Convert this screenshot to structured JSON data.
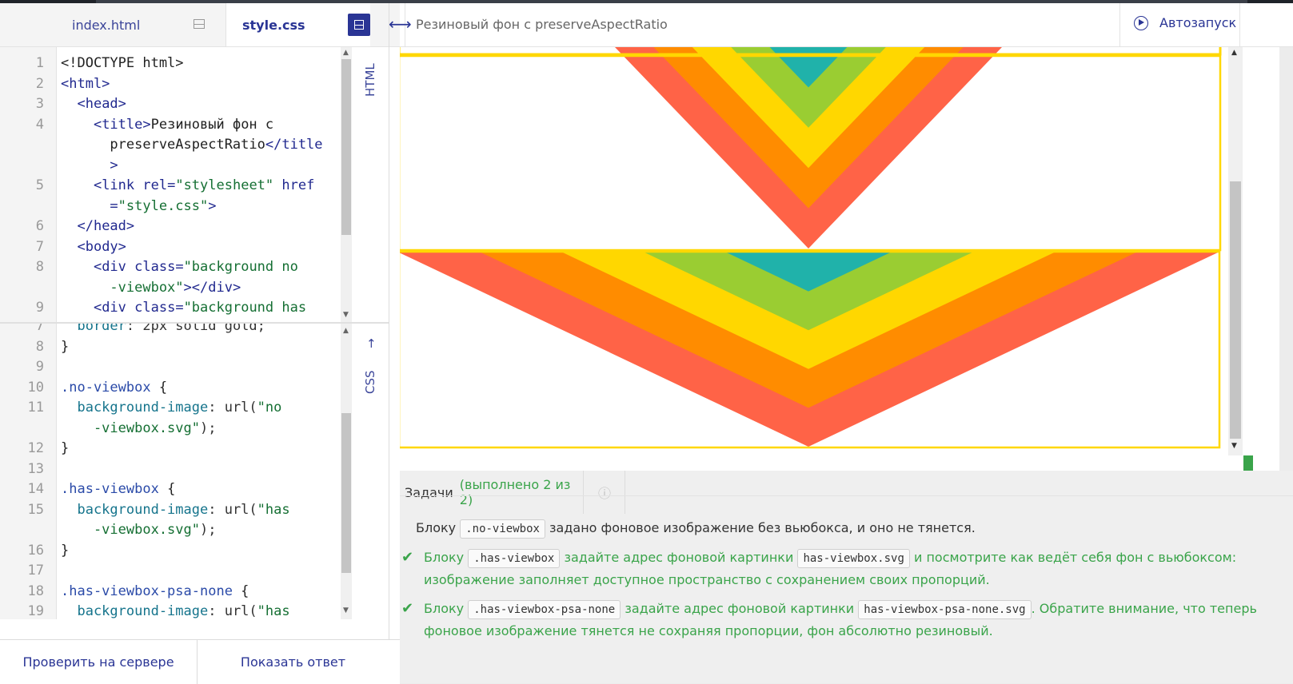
{
  "tabs": {
    "index": "index.html",
    "style": "style.css"
  },
  "side_labels": {
    "html": "HTML",
    "css": "CSS"
  },
  "html_code": {
    "lines": [
      {
        "n": "1",
        "parts": [
          [
            "t-txt",
            "<!DOCTYPE html>"
          ]
        ]
      },
      {
        "n": "2",
        "parts": [
          [
            "t-tag",
            "<html>"
          ]
        ]
      },
      {
        "n": "3",
        "parts": [
          [
            "t-txt",
            "  "
          ],
          [
            "t-tag",
            "<head>"
          ]
        ]
      },
      {
        "n": "4",
        "parts": [
          [
            "t-txt",
            "    "
          ],
          [
            "t-tag",
            "<title>"
          ],
          [
            "t-txt",
            "Резиновый фон с"
          ]
        ]
      },
      {
        "n": "",
        "parts": [
          [
            "t-txt",
            "      preserveAspectRatio"
          ],
          [
            "t-tag",
            "</title"
          ]
        ]
      },
      {
        "n": "",
        "parts": [
          [
            "t-tag",
            "      >"
          ]
        ]
      },
      {
        "n": "5",
        "parts": [
          [
            "t-txt",
            "    "
          ],
          [
            "t-tag",
            "<link "
          ],
          [
            "t-attr",
            "rel="
          ],
          [
            "t-str",
            "\"stylesheet\""
          ],
          [
            "t-attr",
            " href"
          ]
        ]
      },
      {
        "n": "",
        "parts": [
          [
            "t-attr",
            "      ="
          ],
          [
            "t-str",
            "\"style.css\""
          ],
          [
            "t-tag",
            ">"
          ]
        ]
      },
      {
        "n": "6",
        "parts": [
          [
            "t-txt",
            "  "
          ],
          [
            "t-tag",
            "</head>"
          ]
        ]
      },
      {
        "n": "7",
        "parts": [
          [
            "t-txt",
            "  "
          ],
          [
            "t-tag",
            "<body>"
          ]
        ]
      },
      {
        "n": "8",
        "parts": [
          [
            "t-txt",
            "    "
          ],
          [
            "t-tag",
            "<div "
          ],
          [
            "t-attr",
            "class="
          ],
          [
            "t-str",
            "\"background no"
          ]
        ]
      },
      {
        "n": "",
        "parts": [
          [
            "t-str",
            "      -viewbox\""
          ],
          [
            "t-tag",
            "></div>"
          ]
        ]
      },
      {
        "n": "9",
        "parts": [
          [
            "t-txt",
            "    "
          ],
          [
            "t-tag",
            "<div "
          ],
          [
            "t-attr",
            "class="
          ],
          [
            "t-str",
            "\"background has"
          ]
        ]
      }
    ]
  },
  "css_code": {
    "lines": [
      {
        "n": "7",
        "parts": [
          [
            "t-prop",
            "  border"
          ],
          [
            "t-val",
            ": 2px solid gold;"
          ]
        ]
      },
      {
        "n": "8",
        "parts": [
          [
            "t-brace",
            "}"
          ]
        ]
      },
      {
        "n": "9",
        "parts": [
          [
            "t-txt",
            ""
          ]
        ]
      },
      {
        "n": "10",
        "parts": [
          [
            "t-sel",
            ".no-viewbox"
          ],
          [
            "t-brace",
            " {"
          ]
        ]
      },
      {
        "n": "11",
        "parts": [
          [
            "t-prop",
            "  background-image"
          ],
          [
            "t-val",
            ": url("
          ],
          [
            "t-str",
            "\"no"
          ]
        ]
      },
      {
        "n": "",
        "parts": [
          [
            "t-str",
            "    -viewbox.svg\""
          ],
          [
            "t-val",
            ");"
          ]
        ]
      },
      {
        "n": "12",
        "parts": [
          [
            "t-brace",
            "}"
          ]
        ]
      },
      {
        "n": "13",
        "parts": [
          [
            "t-txt",
            ""
          ]
        ]
      },
      {
        "n": "14",
        "parts": [
          [
            "t-sel",
            ".has-viewbox"
          ],
          [
            "t-brace",
            " {"
          ]
        ]
      },
      {
        "n": "15",
        "parts": [
          [
            "t-prop",
            "  background-image"
          ],
          [
            "t-val",
            ": url("
          ],
          [
            "t-str",
            "\"has"
          ]
        ]
      },
      {
        "n": "",
        "parts": [
          [
            "t-str",
            "    -viewbox.svg\""
          ],
          [
            "t-val",
            ");"
          ]
        ]
      },
      {
        "n": "16",
        "parts": [
          [
            "t-brace",
            "}"
          ]
        ]
      },
      {
        "n": "17",
        "parts": [
          [
            "t-txt",
            ""
          ]
        ]
      },
      {
        "n": "18",
        "parts": [
          [
            "t-sel",
            ".has-viewbox-psa-none"
          ],
          [
            "t-brace",
            " {"
          ]
        ]
      },
      {
        "n": "19",
        "parts": [
          [
            "t-prop",
            "  background-image"
          ],
          [
            "t-val",
            ": url("
          ],
          [
            "t-str",
            "\"has"
          ]
        ]
      }
    ]
  },
  "buttons": {
    "check": "Проверить на сервере",
    "answer": "Показать ответ"
  },
  "preview": {
    "title": "Резиновый фон с preserveAspectRatio",
    "autorun": "Автозапуск",
    "resize_glyph": "⟷"
  },
  "tasks": {
    "tab_label": "Задачи",
    "tab_status": "(выполнено 2 из 2)",
    "info_glyph": "ⓘ",
    "intro": {
      "a": "Блоку",
      "chip1": ".no-viewbox",
      "b": "задано фоновое изображение без вьюбокса, и оно не тянется."
    },
    "task1": {
      "a": "Блоку",
      "chip1": ".has-viewbox",
      "b": "задайте адрес фоновой картинки",
      "chip2": "has-viewbox.svg",
      "c": "и посмотрите как ведёт себя фон с вьюбоксом:",
      "d": "изображение заполняет доступное пространство с сохранением своих пропорций."
    },
    "task2": {
      "a": "Блоку",
      "chip1": ".has-viewbox-psa-none",
      "b": "задайте адрес фоновой картинки",
      "chip2": "has-viewbox-psa-none.svg",
      "c": ". Обратите внимание, что теперь",
      "d": "фоновое изображение тянется не сохраняя пропорции, фон абсолютно резиновый."
    },
    "check_glyph": "✔"
  },
  "colors": {
    "stripes": [
      "#ff6347",
      "#ff8c00",
      "#ffd700",
      "#9acd32",
      "#20b2aa"
    ],
    "frame": "#ffd700",
    "accent": "#2a3595",
    "done": "#3aa44a"
  }
}
